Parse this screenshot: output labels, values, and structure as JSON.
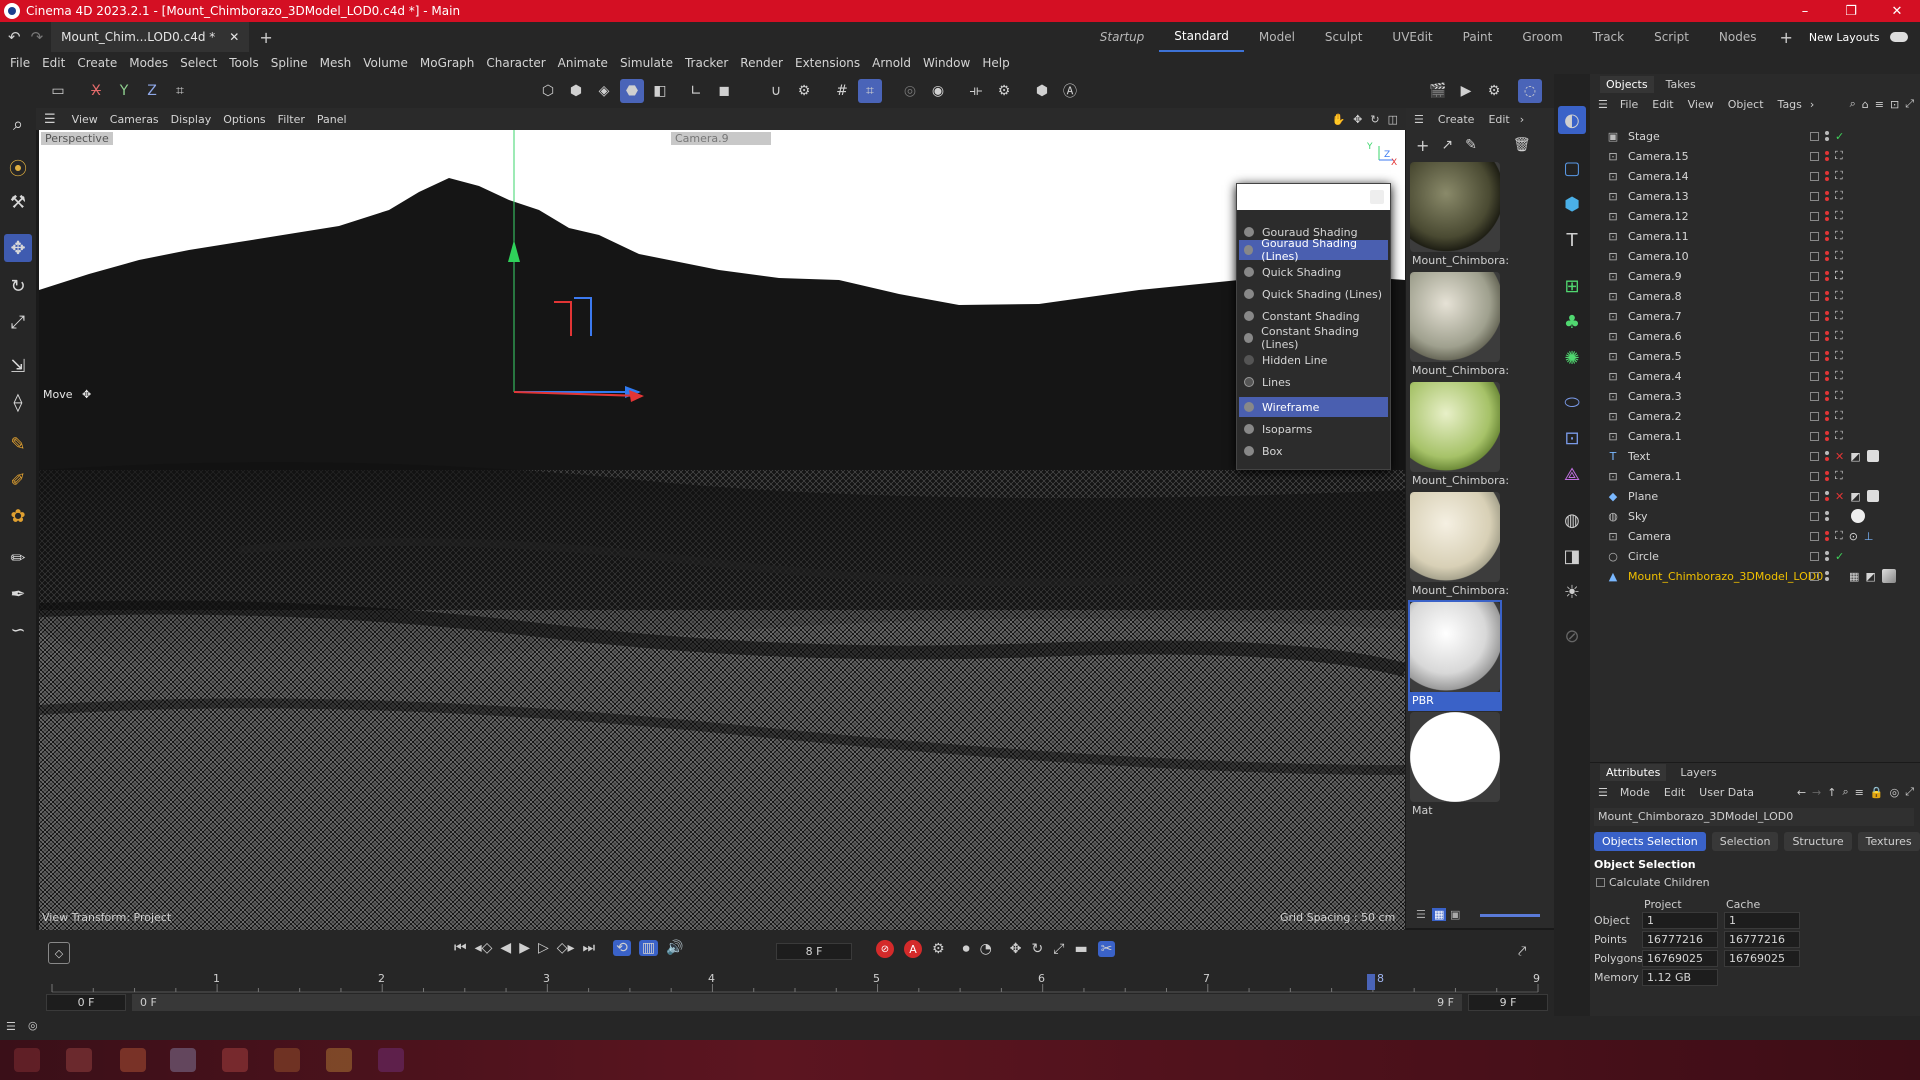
{
  "window": {
    "title": "Cinema 4D 2023.2.1 - [Mount_Chimborazo_3DModel_LOD0.c4d *] - Main",
    "minimize": "–",
    "maximize": "❐",
    "close": "✕"
  },
  "tabs": {
    "doc_tab": "Mount_Chim...LOD0.c4d *",
    "layouts": [
      "Startup",
      "Standard",
      "Model",
      "Sculpt",
      "UVEdit",
      "Paint",
      "Groom",
      "Track",
      "Script",
      "Nodes"
    ],
    "active_layout": "Standard",
    "new_layouts": "New Layouts"
  },
  "menu": [
    "File",
    "Edit",
    "Create",
    "Modes",
    "Select",
    "Tools",
    "Spline",
    "Mesh",
    "Volume",
    "MoGraph",
    "Character",
    "Animate",
    "Simulate",
    "Tracker",
    "Render",
    "Extensions",
    "Arnold",
    "Window",
    "Help"
  ],
  "axes": {
    "x": "X",
    "y": "Y",
    "z": "Z"
  },
  "viewport": {
    "menu": [
      "View",
      "Cameras",
      "Display",
      "Options",
      "Filter",
      "Panel"
    ],
    "label": "Perspective",
    "camera": "Camera.9",
    "tool": "Move",
    "status_left": "View Transform: Project",
    "status_right": "Grid Spacing : 50 cm",
    "axis_marker_y": "Y",
    "axis_marker_z": "Z",
    "axis_marker_x": "X"
  },
  "shading_menu": {
    "items": [
      "Gouraud Shading",
      "Gouraud Shading (Lines)",
      "Quick Shading",
      "Quick Shading (Lines)",
      "Constant Shading",
      "Constant Shading (Lines)",
      "Hidden Line",
      "Lines",
      "Wireframe",
      "Isoparms",
      "Box"
    ],
    "selected": [
      "Gouraud Shading (Lines)",
      "Wireframe"
    ]
  },
  "materials": {
    "menu": [
      "Create",
      "Edit"
    ],
    "items": [
      "Mount_Chimbora:",
      "Mount_Chimbora:",
      "Mount_Chimbora:",
      "Mount_Chimbora:",
      "PBR",
      "Mat"
    ],
    "selected_index": 4
  },
  "objects": {
    "tabs": [
      "Objects",
      "Takes"
    ],
    "menu": [
      "File",
      "Edit",
      "View",
      "Object",
      "Tags"
    ],
    "rows": [
      "Stage",
      "Camera.15",
      "Camera.14",
      "Camera.13",
      "Camera.12",
      "Camera.11",
      "Camera.10",
      "Camera.9",
      "Camera.8",
      "Camera.7",
      "Camera.6",
      "Camera.5",
      "Camera.4",
      "Camera.3",
      "Camera.2",
      "Camera.1",
      "Text",
      "Camera.1",
      "Plane",
      "Sky",
      "Camera",
      "Circle",
      "Mount_Chimborazo_3DModel_LOD0"
    ],
    "highlight": "Mount_Chimborazo_3DModel_LOD0"
  },
  "attributes": {
    "tabs": [
      "Attributes",
      "Layers"
    ],
    "menu": [
      "Mode",
      "Edit",
      "User Data"
    ],
    "object_name": "Mount_Chimborazo_3DModel_LOD0",
    "buttons": [
      "Objects Selection",
      "Selection",
      "Structure",
      "Textures"
    ],
    "section": "Object Selection",
    "calc_children": "Calculate Children",
    "col_project": "Project",
    "col_cache": "Cache",
    "rows": [
      {
        "label": "Object",
        "project": "1",
        "cache": "1"
      },
      {
        "label": "Points",
        "project": "16777216",
        "cache": "16777216"
      },
      {
        "label": "Polygons",
        "project": "16769025",
        "cache": "16769025"
      },
      {
        "label": "Memory",
        "project": "1.12 GB",
        "cache": ""
      }
    ]
  },
  "timeline": {
    "frame_field": "8 F",
    "ruler": [
      "1",
      "2",
      "3",
      "4",
      "5",
      "6",
      "7",
      "8",
      "9"
    ],
    "start": "0 F",
    "range_start": "0 F",
    "range_end": "9 F",
    "end": "9 F"
  },
  "colors": {
    "accent": "#3d72d6",
    "title_bar": "#d40f23",
    "highlight_text": "#f0c000"
  }
}
